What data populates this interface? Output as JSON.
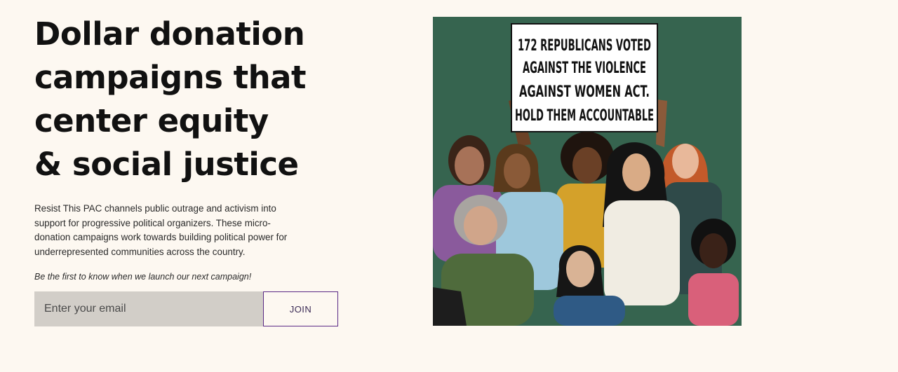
{
  "hero": {
    "headline": [
      "Dollar donation",
      "campaigns that",
      "center equity",
      "& social justice"
    ],
    "description": "Resist This PAC channels public outrage and activism into support for progressive political organizers. These micro-donation campaigns work towards building political power for underrepresented communities across the country.",
    "cta_note": "Be the first to know when we launch our next campaign!"
  },
  "signup": {
    "email_placeholder": "Enter your email",
    "email_value": "",
    "join_label": "JOIN"
  },
  "illustration": {
    "sign_lines": [
      "172 REPUBLICANS VOTED",
      "AGAINST THE VIOLENCE",
      "AGAINST WOMEN ACT.",
      "HOLD THEM ACCOUNTABLE"
    ]
  },
  "colors": {
    "page_background": "#fdf8f1",
    "illustration_background": "#36644f",
    "join_border": "#5b2b86",
    "email_background": "#d2cec8"
  }
}
